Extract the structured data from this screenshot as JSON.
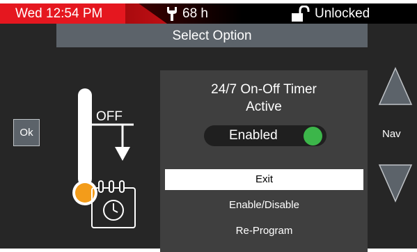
{
  "status_bar": {
    "datetime": "Wed 12:54 PM",
    "hours": "68 h",
    "lock_status": "Unlocked",
    "accent_color": "#e5171f"
  },
  "title": "Select Option",
  "ok_button": "Ok",
  "thermometer": {
    "off_label": "OFF"
  },
  "timer": {
    "title": "24/7 On-Off Timer",
    "state": "Active",
    "toggle_label": "Enabled",
    "toggle_on": true,
    "toggle_color": "#3cb64a"
  },
  "menu": {
    "items": [
      "Exit",
      "Enable/Disable",
      "Re-Program"
    ],
    "selected": "Exit"
  },
  "nav": {
    "label": "Nav"
  }
}
